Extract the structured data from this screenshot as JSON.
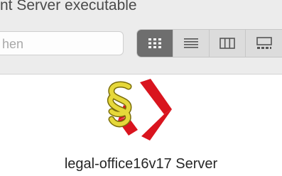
{
  "window": {
    "title": "nt Server executable"
  },
  "search": {
    "placeholder": "hen"
  },
  "view_modes": [
    {
      "icon": "icon-view-icon",
      "active": true
    },
    {
      "icon": "list-view-icon",
      "active": false
    },
    {
      "icon": "column-view-icon",
      "active": false
    },
    {
      "icon": "gallery-view-icon",
      "active": false
    }
  ],
  "file": {
    "name": "legal-office16v17 Server",
    "icon": "legal-office-app-icon"
  },
  "colors": {
    "toolbar_bg": "#ececec",
    "active_view": "#6e6e6e",
    "logo_red": "#d9141e",
    "logo_gold": "#d6c21a"
  }
}
